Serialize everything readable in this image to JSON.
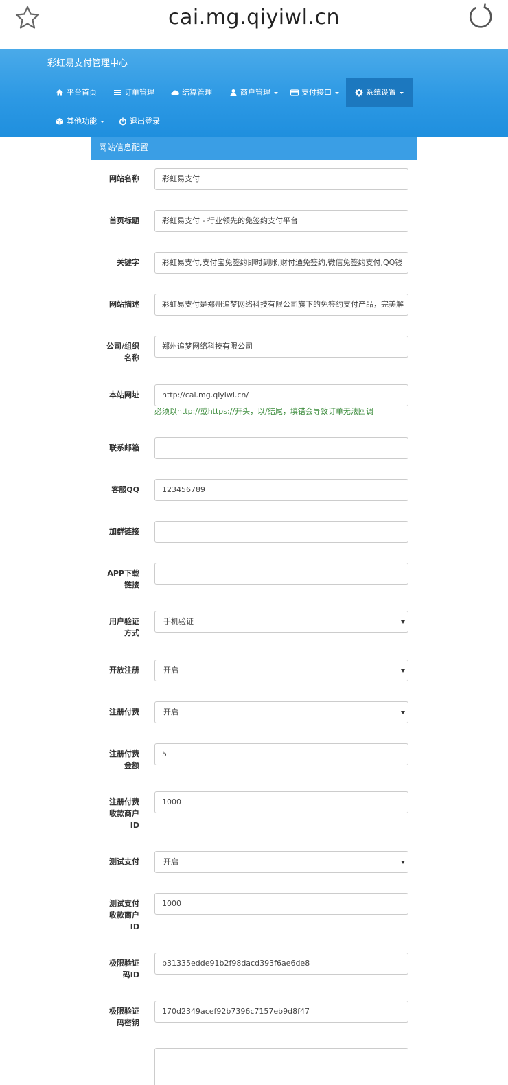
{
  "browser": {
    "url": "cai.mg.qiyiwl.cn"
  },
  "navbar": {
    "brand": "彩虹易支付管理中心",
    "items": [
      {
        "label": "平台首页",
        "icon": "home-icon"
      },
      {
        "label": "订单管理",
        "icon": "list-icon"
      },
      {
        "label": "结算管理",
        "icon": "cloud-icon"
      },
      {
        "label": "商户管理",
        "icon": "user-icon"
      },
      {
        "label": "支付接口",
        "icon": "credit-card-icon"
      },
      {
        "label": "系统设置",
        "icon": "gear-icon"
      },
      {
        "label": "其他功能",
        "icon": "cube-icon"
      },
      {
        "label": "退出登录",
        "icon": "power-icon"
      }
    ],
    "active_color": "#1c78bf"
  },
  "panel": {
    "title": "网站信息配置",
    "fields": [
      {
        "label": "网站名称",
        "value": "彩虹易支付"
      },
      {
        "label": "首页标题",
        "value": "彩虹易支付 - 行业领先的免签约支付平台"
      },
      {
        "label": "关键字",
        "value": "彩虹易支付,支付宝免签约即时到账,财付通免签约,微信免签约支付,QQ钱"
      },
      {
        "label": "网站描述",
        "value": "彩虹易支付是郑州追梦网络科技有限公司旗下的免签约支付产品，完美解"
      },
      {
        "label": "公司/组织名称",
        "label_lines": [
          "公司/组织",
          "名称"
        ],
        "value": "郑州追梦网络科技有限公司"
      },
      {
        "label": "本站网址",
        "value": "http://cai.mg.qiyiwl.cn/",
        "help": "必须以http://或https://开头，以/结尾，填错会导致订单无法回调"
      },
      {
        "label": "联系邮箱",
        "value": ""
      },
      {
        "label": "客服QQ",
        "value": "123456789"
      },
      {
        "label": "加群链接",
        "value": ""
      },
      {
        "label": "APP下载链接",
        "label_lines": [
          "APP下载",
          "链接"
        ],
        "value": ""
      },
      {
        "label": "用户验证方式",
        "label_lines": [
          "用户验证",
          "方式"
        ],
        "value": "手机验证",
        "type": "select"
      },
      {
        "label": "开放注册",
        "value": "开启",
        "type": "select"
      },
      {
        "label": "注册付费",
        "value": "开启",
        "type": "select"
      },
      {
        "label": "注册付费金额",
        "label_lines": [
          "注册付费",
          "金额"
        ],
        "value": "5"
      },
      {
        "label": "注册付费收款商户ID",
        "label_lines": [
          "注册付费",
          "收款商户",
          "ID"
        ],
        "value": "1000"
      },
      {
        "label": "测试支付",
        "value": "开启",
        "type": "select"
      },
      {
        "label": "测试支付收款商户ID",
        "label_lines": [
          "测试支付",
          "收款商户",
          "ID"
        ],
        "value": "1000"
      },
      {
        "label": "极限验证码ID",
        "label_lines": [
          "极限验证",
          "码ID"
        ],
        "value": "b31335edde91b2f98dacd393f6ae6de8"
      },
      {
        "label": "极限验证码密钥",
        "label_lines": [
          "极限验证",
          "码密钥"
        ],
        "value": "170d2349acef92b7396c7157eb9d8f47"
      }
    ]
  }
}
